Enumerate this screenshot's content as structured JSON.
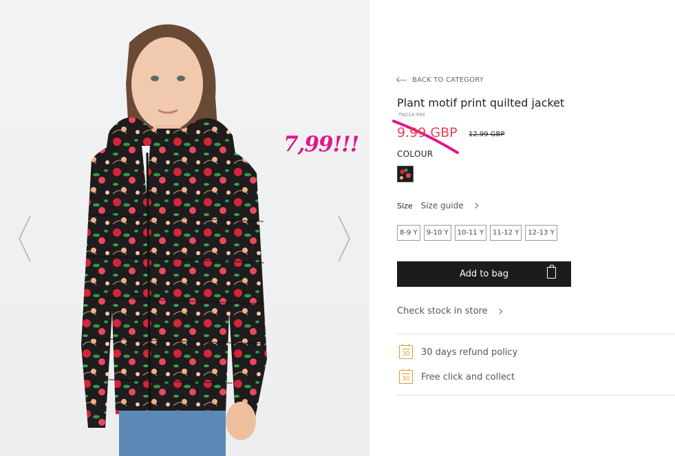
{
  "gallery": {
    "prev_icon": "chevron-left-icon",
    "next_icon": "chevron-right-icon"
  },
  "annotation": "7,99!!!",
  "product": {
    "back_label": "BACK TO CATEGORY",
    "title": "Plant motif print quilted jacket",
    "sku": "TN214-99X",
    "price": "9.99 GBP",
    "old_price": "12.99 GBP",
    "colour_label": "COLOUR",
    "size_label": "Size",
    "size_guide": "Size guide",
    "sizes": [
      "8-9 Y",
      "9-10 Y",
      "10-11 Y",
      "11-12 Y",
      "12-13 Y"
    ],
    "add_to_bag": "Add to bag",
    "check_stock": "Check stock in store",
    "perks": [
      "30 days refund policy",
      "Free click and collect"
    ],
    "calendar_number": "30"
  },
  "colors": {
    "price_red": "#e3424f",
    "annotation_pink": "#e0168c",
    "button_dark": "#1c1c1c",
    "perk_icon": "#d99a2b"
  }
}
